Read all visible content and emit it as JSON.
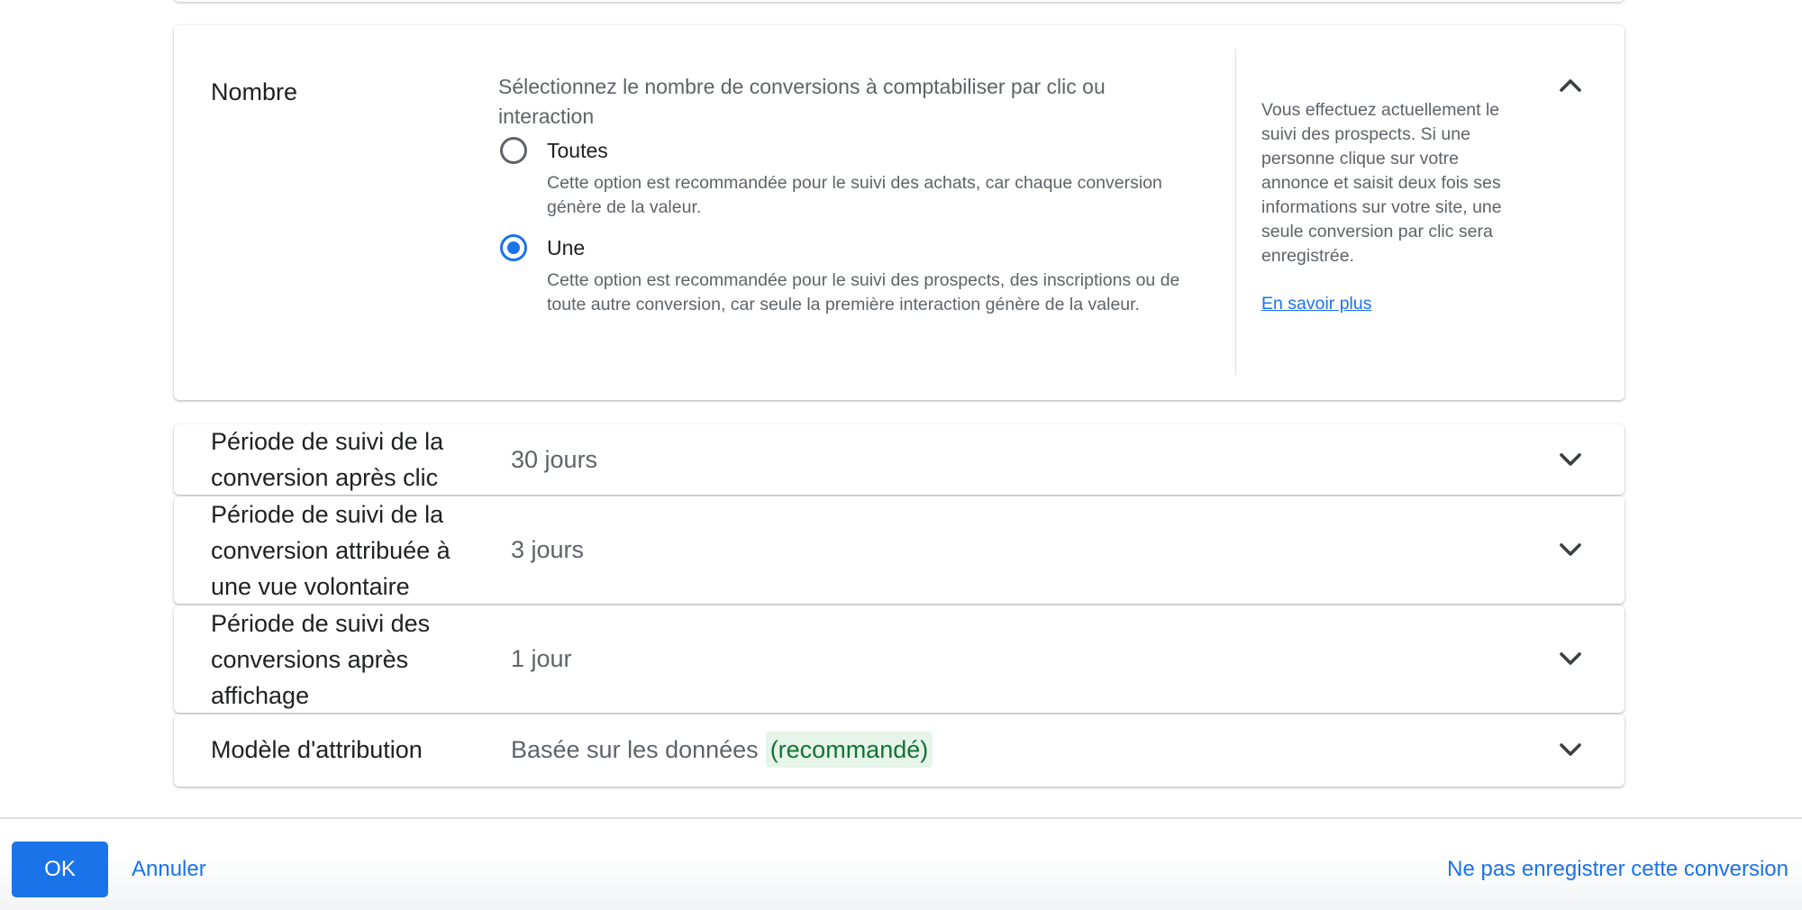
{
  "count_section": {
    "title": "Nombre",
    "description": "Sélectionnez le nombre de conversions à comptabiliser par clic ou interaction",
    "options": [
      {
        "label": "Toutes",
        "help": "Cette option est recommandée pour le suivi des achats, car chaque conversion génère de la valeur.",
        "selected": false
      },
      {
        "label": "Une",
        "help": "Cette option est recommandée pour le suivi des prospects, des inscriptions ou de toute autre conversion, car seule la première interaction génère de la valeur.",
        "selected": true
      }
    ],
    "side_info": "Vous effectuez actuellement le suivi des prospects. Si une personne clique sur votre annonce et saisit deux fois ses informations sur votre site, une seule conversion par clic sera enregistrée.",
    "learn_more": "En savoir plus",
    "collapse_icon": "chevron-up-icon"
  },
  "sections": [
    {
      "title": "Période de suivi de la conversion après clic",
      "value": "30 jours",
      "expand_icon": "chevron-down-icon"
    },
    {
      "title": "Période de suivi de la conversion attribuée à une vue volontaire",
      "value": "3 jours",
      "expand_icon": "chevron-down-icon"
    },
    {
      "title": "Période de suivi des conversions après affichage",
      "value": "1 jour",
      "expand_icon": "chevron-down-icon"
    },
    {
      "title": "Modèle d'attribution",
      "value": "Basée sur les données",
      "badge": "(recommandé)",
      "expand_icon": "chevron-down-icon"
    }
  ],
  "footer": {
    "ok_label": "OK",
    "cancel_label": "Annuler",
    "discard_label": "Ne pas enregistrer cette conversion"
  },
  "colors": {
    "accent": "#1a73e8",
    "recommended_bg": "#e6f4ea",
    "recommended_text": "#137333"
  }
}
